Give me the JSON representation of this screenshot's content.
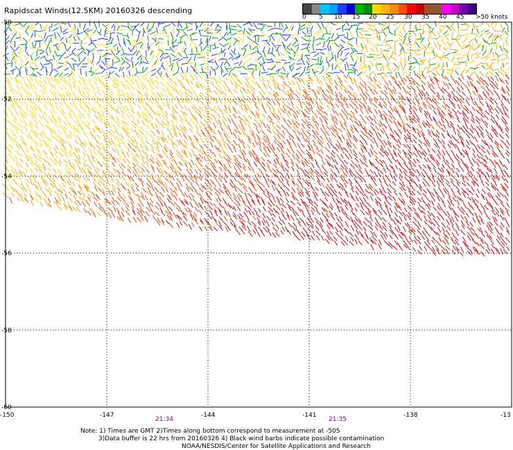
{
  "title": "Rapidscat Winds(12.5KM) 20160326 descending",
  "legend": {
    "colors": [
      "#444444",
      "#888888",
      "#00c8ff",
      "#00a0ff",
      "#1e3cff",
      "#0000c8",
      "#00b400",
      "#008c00",
      "#ffd700",
      "#ffb400",
      "#ff8c00",
      "#ff5000",
      "#ff0000",
      "#c80000",
      "#a05028",
      "#8c5a32",
      "#ff00ff",
      "#c800c8",
      "#7800b4",
      "#3c0078"
    ],
    "labels": [
      "0",
      "5",
      "10",
      "15",
      "20",
      "25",
      "30",
      "35",
      "40",
      "45",
      ">50 knots"
    ]
  },
  "lat_labels": [
    "-50",
    "-52",
    "-54",
    "-56",
    "-58",
    "-60"
  ],
  "lon_labels": [
    "-150",
    "-147",
    "-144",
    "-141",
    "-138",
    "-13"
  ],
  "times": [
    "21:34",
    "21:35"
  ],
  "notes": [
    "Note: 1) Times are GMT 2)Times along bottom correspond to measurement at -50S",
    "3)Data buffer is 22 hrs from 20160326 4) Black wind barbs indicate possible contamination",
    "NOAA/NESDIS/Center for Satellite Applications and Research"
  ],
  "wind_color_scale": {
    "calm": "#1e3cff",
    "light": "#00a000",
    "moderate": "#ffd700",
    "fresh": "#ffa500",
    "strong": "#ff4000",
    "gale": "#e00000",
    "storm": "#ff00ff"
  }
}
